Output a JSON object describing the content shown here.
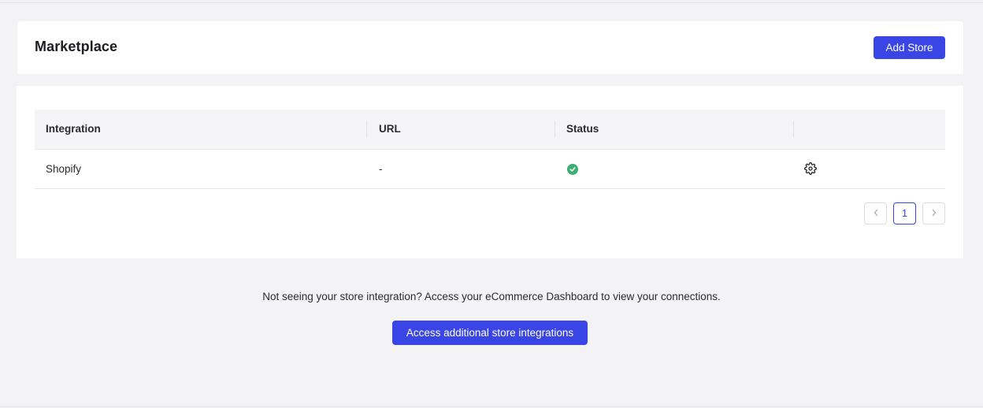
{
  "header": {
    "title": "Marketplace",
    "add_store_label": "Add Store"
  },
  "table": {
    "columns": [
      "Integration",
      "URL",
      "Status",
      ""
    ],
    "rows": [
      {
        "integration": "Shopify",
        "url": "-",
        "status": "connected",
        "status_color": "#3fae72",
        "settings_icon": "gear-icon"
      }
    ]
  },
  "pagination": {
    "current_page": "1",
    "prev_icon": "chevron-left-icon",
    "next_icon": "chevron-right-icon"
  },
  "footer": {
    "notice": "Not seeing your store integration? Access your eCommerce Dashboard to view your connections.",
    "access_label": "Access additional store integrations"
  },
  "colors": {
    "accent": "#3a45e6",
    "success": "#3fae72",
    "background": "#f3f3f6"
  }
}
